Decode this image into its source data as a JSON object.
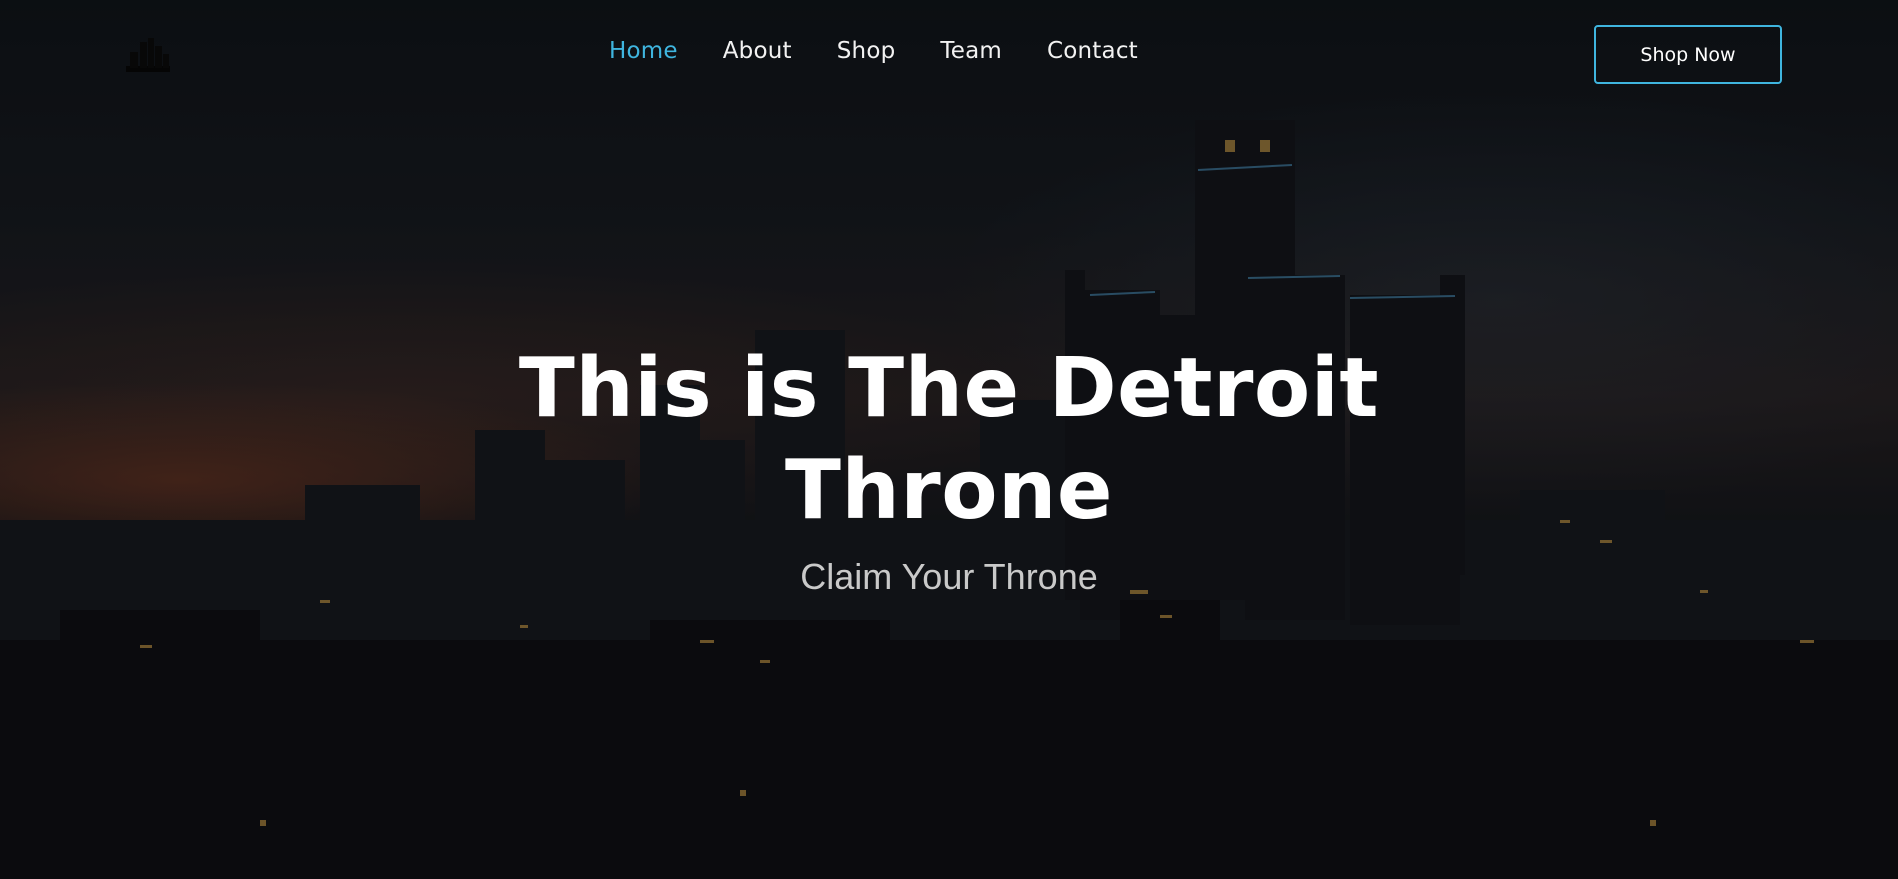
{
  "nav": {
    "items": [
      {
        "label": "Home",
        "active": true
      },
      {
        "label": "About",
        "active": false
      },
      {
        "label": "Shop",
        "active": false
      },
      {
        "label": "Team",
        "active": false
      },
      {
        "label": "Contact",
        "active": false
      }
    ],
    "cta_label": "Shop Now"
  },
  "hero": {
    "headline_line1": "This is The Detroit",
    "headline_line2": "Throne",
    "subheadline": "Claim Your Throne"
  },
  "colors": {
    "accent": "#3fb5df",
    "text": "#ffffff",
    "subtext": "#c9c9c9"
  },
  "icons": {
    "logo": "city-skyline-logo-icon"
  }
}
